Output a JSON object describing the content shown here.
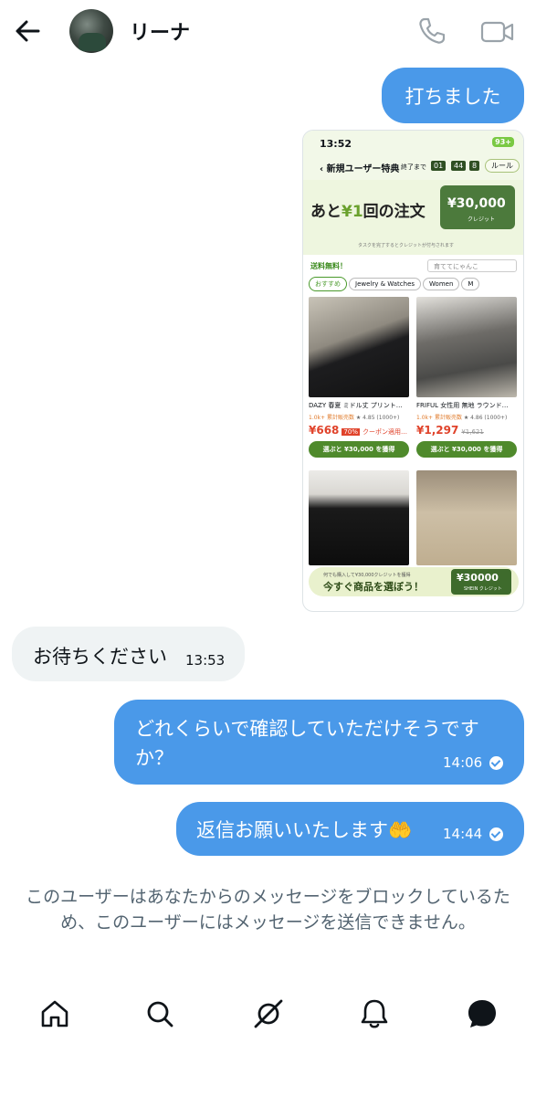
{
  "header": {
    "contact_name": "リーナ",
    "back_icon": "arrow-left-icon",
    "call_icon": "phone-icon",
    "video_icon": "video-camera-icon"
  },
  "messages": {
    "m1": {
      "text": "打ちました",
      "direction": "outgoing"
    },
    "m2": {
      "text": "お待ちください",
      "time": "13:53",
      "direction": "incoming"
    },
    "m3": {
      "text": "どれくらいで確認していただけそうですか？",
      "time": "14:06",
      "direction": "outgoing",
      "status": "read"
    },
    "m4": {
      "text": "返信お願いいたします🤲",
      "time": "14:44",
      "direction": "outgoing",
      "status": "read"
    }
  },
  "shared_screenshot": {
    "status_time": "13:52",
    "battery": "93+",
    "page_title": "新規ユーザー特典",
    "end_label": "終了まで",
    "countdown": [
      "01",
      "44",
      "8"
    ],
    "rule_label": "ルール",
    "banner_text_pre": "あと",
    "banner_yen": "¥1",
    "banner_text_post": "回の注文",
    "credit_amount": "¥30,000",
    "credit_label": "クレジット",
    "banner_note": "タスクを完了するとクレジットが付与されます",
    "free_shipping": "送料無料！",
    "search_placeholder": "育ててにゃんこ",
    "chips": [
      "おすすめ",
      "Jewelry & Watches",
      "Women",
      "M"
    ],
    "products": [
      {
        "name": "DAZY 春夏 ミドル丈 プリント…",
        "sold": "1.0k+ 累計販売数",
        "rating": "4.85 (1000+)",
        "price": "¥668",
        "discount": "70%",
        "extra": "クーポン適用…",
        "button": "選ぶと ¥30,000 を獲得"
      },
      {
        "name": "FRIFUL 女性用 無地 ラウンド…",
        "sold": "1.0k+ 累計販売数",
        "rating": "4.86 (1000+)",
        "price": "¥1,297",
        "old_price": "¥1,621",
        "button": "選ぶと ¥30,000 を獲得"
      }
    ],
    "footer_line1": "何でも購入して¥30,000クレジットを獲得",
    "footer_line2": "今すぐ商品を選ぼう！",
    "footer_value": "¥30000",
    "footer_sub": "SHEIN クレジット"
  },
  "notice": {
    "blocked_text": "このユーザーはあなたからのメッセージをブロックしているため、このユーザーにはメッセージを送信できません。"
  },
  "nav": {
    "items": [
      "home-icon",
      "search-icon",
      "grok-icon",
      "bell-icon",
      "messages-icon"
    ]
  },
  "colors": {
    "outgoing_bubble": "#4a99e9",
    "incoming_bubble": "#eff3f4",
    "muted_text": "#536471"
  }
}
